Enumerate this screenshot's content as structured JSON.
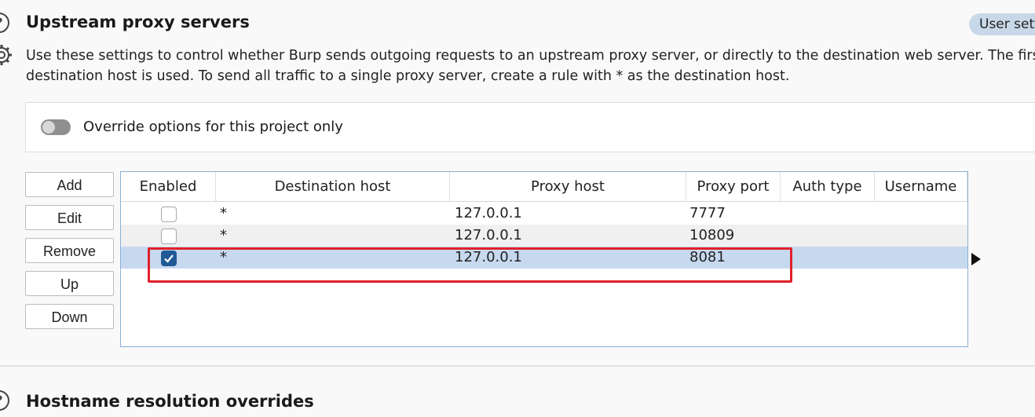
{
  "section": {
    "title": "Upstream proxy servers",
    "badge": "User sett",
    "description_line1": "Use these settings to  control whether Burp sends outgoing requests to an upstream proxy server, or directly to the destination web server. The first ru",
    "description_line2": "destination host is used. To send all traffic to a single proxy server, create a rule with * as the destination host."
  },
  "override": {
    "label": "Override options for this project only",
    "enabled": false
  },
  "buttons": {
    "add": "Add",
    "edit": "Edit",
    "remove": "Remove",
    "up": "Up",
    "down": "Down"
  },
  "table": {
    "headers": {
      "enabled": "Enabled",
      "destination_host": "Destination host",
      "proxy_host": "Proxy host",
      "proxy_port": "Proxy port",
      "auth_type": "Auth type",
      "username": "Username"
    },
    "rows": [
      {
        "enabled": false,
        "destination_host": "*",
        "proxy_host": "127.0.0.1",
        "proxy_port": "7777",
        "auth_type": "",
        "username": ""
      },
      {
        "enabled": false,
        "destination_host": "*",
        "proxy_host": "127.0.0.1",
        "proxy_port": "10809",
        "auth_type": "",
        "username": ""
      },
      {
        "enabled": true,
        "destination_host": "*",
        "proxy_host": "127.0.0.1",
        "proxy_port": "8081",
        "auth_type": "",
        "username": ""
      }
    ]
  },
  "next_section": {
    "title": "Hostname resolution overrides"
  },
  "colors": {
    "selected_row": "#c7d9ef",
    "alt_row": "#f0f0f0",
    "highlight_box": "#e0202a",
    "checkbox_checked": "#1f5a96"
  }
}
